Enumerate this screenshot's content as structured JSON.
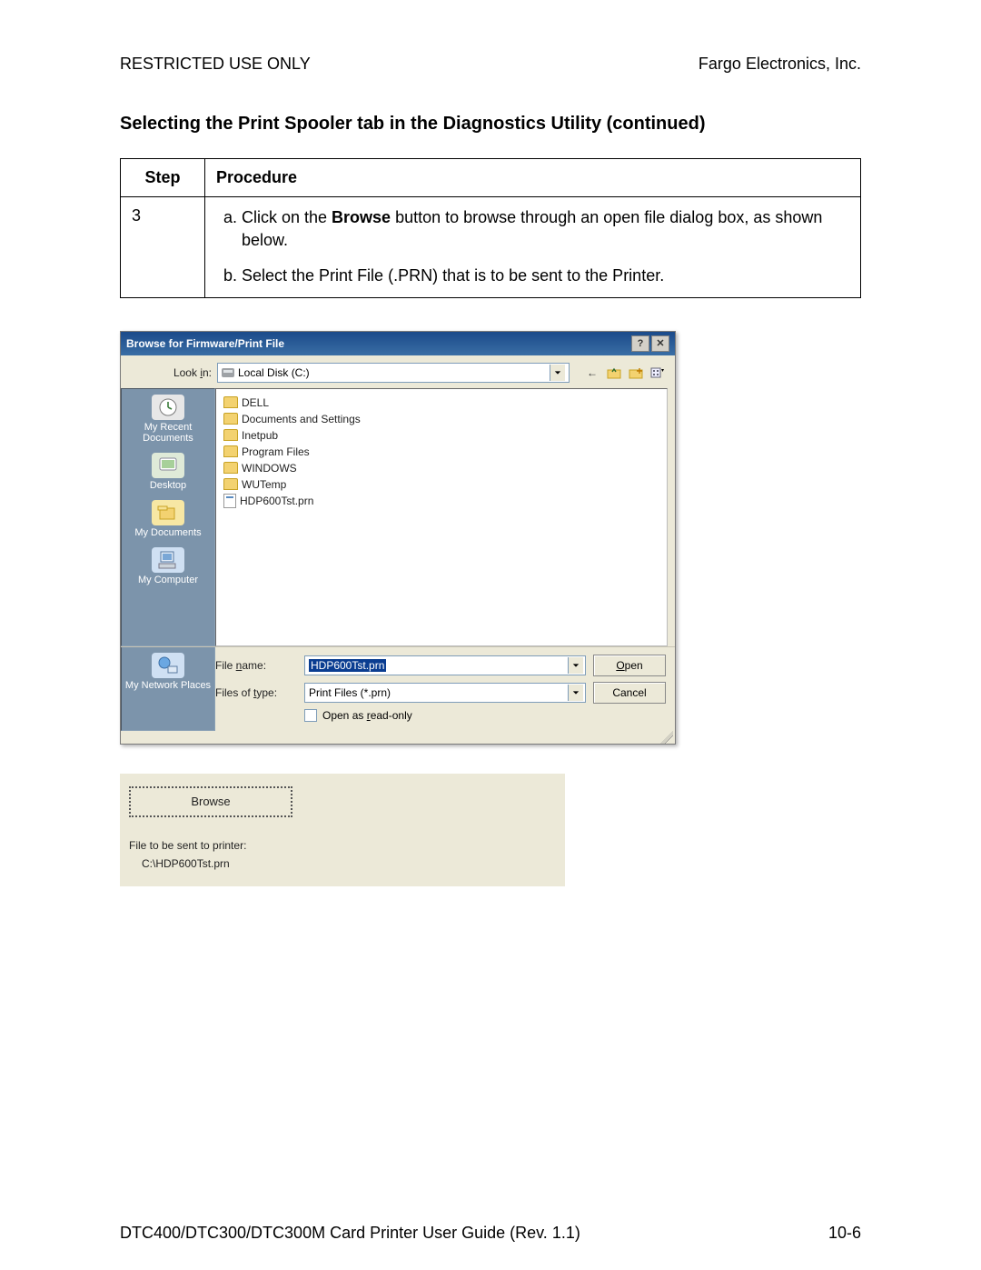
{
  "header": {
    "left": "RESTRICTED USE ONLY",
    "right": "Fargo Electronics, Inc."
  },
  "section_title": "Selecting the Print Spooler tab in the Diagnostics Utility (continued)",
  "table": {
    "headers": {
      "step": "Step",
      "procedure": "Procedure"
    },
    "step_num": "3",
    "proc_a_pre": "Click on the ",
    "proc_a_bold": "Browse",
    "proc_a_post": " button to browse through an open file dialog box, as shown below.",
    "proc_b": "Select the Print File (.PRN) that is to be sent to the Printer."
  },
  "dialog": {
    "title": "Browse for Firmware/Print File",
    "help_glyph": "?",
    "close_glyph": "✕",
    "lookin_label": "Look in:",
    "lookin_value": "Local Disk (C:)",
    "places": {
      "recent": "My Recent Documents",
      "desktop": "Desktop",
      "mydocs": "My Documents",
      "mycomp": "My Computer",
      "network": "My Network Places"
    },
    "files": [
      "DELL",
      "Documents and Settings",
      "Inetpub",
      "Program Files",
      "WINDOWS",
      "WUTemp",
      "HDP600Tst.prn"
    ],
    "filename_label": "File name:",
    "filename_value": "HDP600Tst.prn",
    "filetype_label": "Files of type:",
    "filetype_value": "Print Files (*.prn)",
    "readonly_label": "Open as read-only",
    "open_btn": "Open",
    "cancel_btn": "Cancel"
  },
  "snippet": {
    "browse_btn": "Browse",
    "label": "File to be sent to printer:",
    "path": "C:\\HDP600Tst.prn"
  },
  "footer": {
    "left": "DTC400/DTC300/DTC300M Card Printer User Guide (Rev. 1.1)",
    "right": "10-6"
  }
}
